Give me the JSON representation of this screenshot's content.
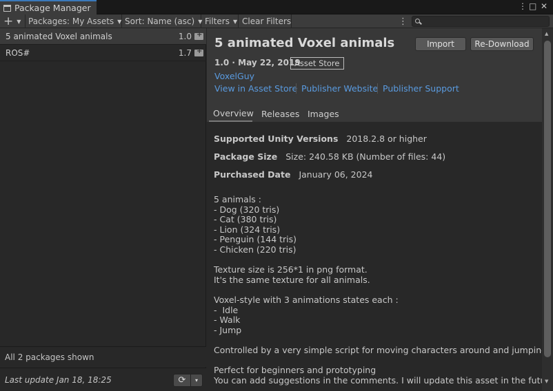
{
  "window": {
    "title": "Package Manager",
    "controls": [
      "⋮",
      "□",
      "✕"
    ]
  },
  "toolbar": {
    "add_label": "+",
    "packages_label": "Packages: My Assets",
    "sort_label": "Sort: Name (asc)",
    "filters_label": "Filters",
    "clear_filters_label": "Clear Filters",
    "more_label": "⋮",
    "search_placeholder": ""
  },
  "packages": [
    {
      "name": "5 animated Voxel animals",
      "version": "1.0",
      "selected": true
    },
    {
      "name": "ROS#",
      "version": "1.7",
      "selected": false
    }
  ],
  "footer": {
    "count_text": "All 2 packages shown",
    "last_update": "Last update Jan 18, 18:25",
    "refresh_icon": "⟳",
    "dropdown_icon": "▾"
  },
  "detail": {
    "title": "5 animated Voxel animals",
    "import_label": "Import",
    "redownload_label": "Re-Download",
    "version_line": "1.0 · May 22, 2019",
    "badge": "Asset Store",
    "author": "VoxelGuy",
    "links": [
      "View in Asset Store",
      "Publisher Website",
      "Publisher Support"
    ],
    "tabs": [
      "Overview",
      "Releases",
      "Images"
    ],
    "info": {
      "unity_label": "Supported Unity Versions",
      "unity_value": "2018.2.8 or higher",
      "size_label": "Package Size",
      "size_value": "Size: 240.58 KB (Number of files: 44)",
      "purchased_label": "Purchased Date",
      "purchased_value": "January 06, 2024"
    },
    "description": "5 animals :\n- Dog (320 tris)\n- Cat (380 tris)\n- Lion (324 tris)\n- Penguin (144 tris)\n- Chicken (220 tris)\n\nTexture size is 256*1 in png format.\nIt's the same texture for all animals.\n\nVoxel-style with 3 animations states each :\n-  Idle\n- Walk\n- Jump\n\nControlled by a very simple script for moving characters around and jumping.\n\nPerfect for beginners and prototyping\nYou can add suggestions in the comments. I will update this asset in the future."
  }
}
